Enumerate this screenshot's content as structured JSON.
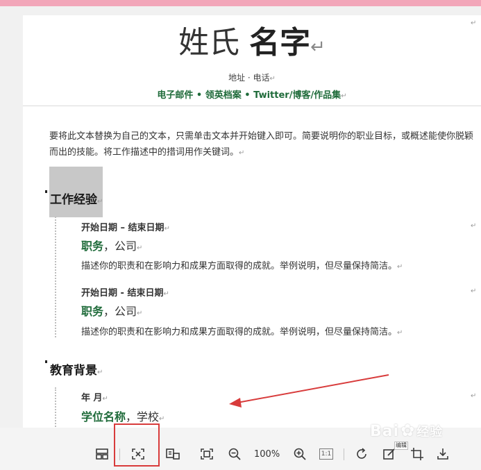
{
  "resume": {
    "name_first": "姓氏",
    "name_last": "名字",
    "return_mark": "↵",
    "address_line": "地址 · 电话",
    "links_line": "电子邮件 • 领英档案 • Twitter/博客/作品集",
    "summary": "要将此文本替换为自己的文本，只需单击文本并开始键入即可。简要说明你的职业目标，或概述能使你脱颖而出的技能。将工作描述中的措词用作关键词。",
    "sections": {
      "experience_heading": "工作经验",
      "education_heading": "教育背景"
    },
    "jobs": [
      {
        "dates": "开始日期 – 结束日期",
        "role": "职务",
        "company": "，公司",
        "description": "描述你的职责和在影响力和成果方面取得的成就。举例说明，但尽量保持简洁。"
      },
      {
        "dates": "开始日期 - 结束日期",
        "role": "职务",
        "company": "，公司",
        "description": "描述你的职责和在影响力和成果方面取得的成就。举例说明，但尽量保持简洁。"
      }
    ],
    "education": {
      "date": "年 月",
      "degree": "学位名称",
      "school": "，学校"
    }
  },
  "toolbar": {
    "zoom_level": "100%",
    "actual_size_label": "1:1",
    "tooltip_text": "编辑"
  },
  "watermark": {
    "brand": "Bai",
    "brand_tail": "经验"
  },
  "colors": {
    "accent_green": "#1f6b3a",
    "annotation_red": "#d83b3b",
    "top_bar_pink": "#f2a6b9"
  }
}
